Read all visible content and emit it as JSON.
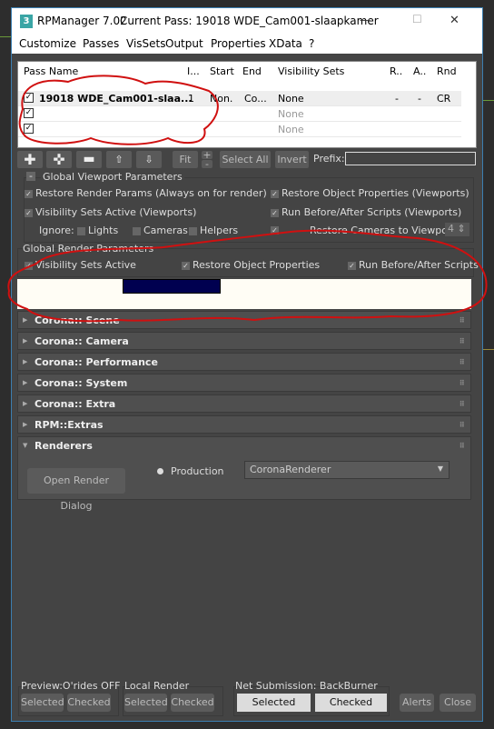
{
  "window": {
    "app_icon": "3ds-max-icon",
    "title": "RPManager 7.02",
    "current_pass_label": "Current Pass: 19018 WDE_Cam001-slaapkamer",
    "minimize": "—",
    "maximize": "☐",
    "close": "✕"
  },
  "menu": [
    "Customize",
    "Passes",
    "VisSets",
    "Output",
    "Properties",
    "XData",
    "?"
  ],
  "grid": {
    "columns": [
      "Pass Name",
      "I...",
      "Start",
      "End",
      "Visibility Sets",
      "R..",
      "A..",
      "Rnd"
    ],
    "rows": [
      {
        "name": "19018 WDE_Cam001-slaa...",
        "i": "1",
        "start": "Non.",
        "end": "Co...",
        "vis": "None",
        "r": "-",
        "a": "-",
        "rnd": "CR",
        "checked": true
      },
      {
        "name": "",
        "vis": "None",
        "checked": true
      },
      {
        "name": "",
        "vis": "None",
        "checked": true
      }
    ]
  },
  "toolbar": {
    "fit": "Fit",
    "plus": "+",
    "minus": "-",
    "select_all": "Select All",
    "invert": "Invert",
    "prefix_label": "Prefix:",
    "prefix_value": ""
  },
  "viewport": {
    "title": "Global Viewport Parameters",
    "collapse": "-",
    "restore_render": "Restore Render Params (Always on for render)",
    "restore_obj": "Restore Object Properties (Viewports)",
    "vis_sets": "Visibility Sets Active (Viewports)",
    "run_scripts": "Run Before/After Scripts (Viewports)",
    "ignore": "Ignore:",
    "lights": "Lights",
    "cameras": "Cameras",
    "helpers": "Helpers",
    "restore_cams": "Restore Cameras to Viewport:",
    "viewport_num": "4"
  },
  "render": {
    "title": "Global Render Parameters",
    "vis_sets": "Visibility Sets Active",
    "restore_obj": "Restore Object Properties",
    "run_scripts": "Run Before/After Scripts"
  },
  "rollouts": [
    "Corona:: Scene",
    "Corona:: Camera",
    "Corona:: Performance",
    "Corona:: System",
    "Corona:: Extra",
    "RPM::Extras"
  ],
  "renderers": {
    "title": "Renderers",
    "open_dialog": "Open Render Dialog",
    "production": "Production",
    "renderer": "CoronaRenderer"
  },
  "bottom": {
    "preview": "Preview:O'rides OFF",
    "local": "Local Render",
    "net": "Net Submission: BackBurner",
    "selected": "Selected",
    "checked": "Checked",
    "alerts": "Alerts",
    "close": "Close"
  },
  "colors": {
    "annotation": "#d01010",
    "accent": "#3c7fb1"
  }
}
